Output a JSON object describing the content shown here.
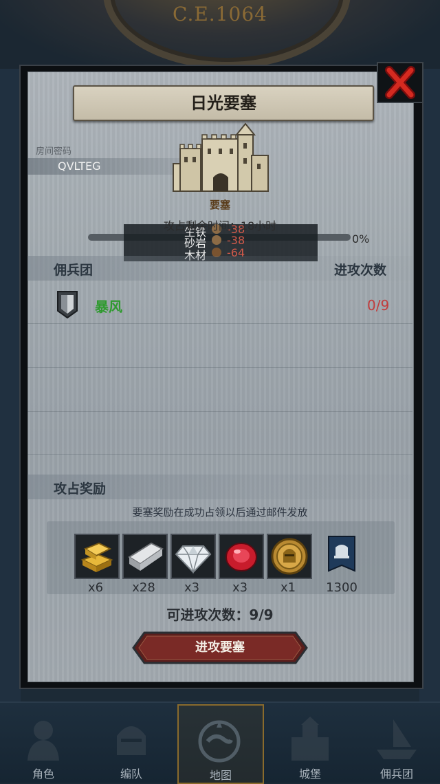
{
  "header": {
    "era": "C.E.1064"
  },
  "dialog": {
    "title": "日光要塞",
    "room_code_label": "房间密码",
    "room_code": "QVLTEG",
    "fortress_type": "要塞",
    "timer_label": "攻占剩余时间：18小时",
    "progress_percent": "0%",
    "resources": [
      {
        "name": "生铁",
        "value": "-38"
      },
      {
        "name": "砂岩",
        "value": "-38"
      },
      {
        "name": "木材",
        "value": "-64"
      }
    ],
    "mercenary_header": "佣兵团",
    "attack_count_header": "进攻次数",
    "mercenaries": [
      {
        "name": "暴风",
        "attacks": "0/9"
      }
    ],
    "reward_header": "攻占奖励",
    "reward_note": "要塞奖励在成功占领以后通过邮件发放",
    "rewards": [
      {
        "icon": "gold-bar-icon",
        "count": "x6"
      },
      {
        "icon": "iron-bar-icon",
        "count": "x28"
      },
      {
        "icon": "diamond-icon",
        "count": "x3"
      },
      {
        "icon": "ruby-icon",
        "count": "x3"
      },
      {
        "icon": "knight-coin-icon",
        "count": "x1"
      },
      {
        "icon": "banner-icon",
        "count": "1300"
      }
    ],
    "attempts_text": "可进攻次数：9/9",
    "attack_button": "进攻要塞"
  },
  "nav": {
    "items": [
      {
        "label": "角色",
        "icon": "knight-icon"
      },
      {
        "label": "编队",
        "icon": "helmet-icon"
      },
      {
        "label": "地图",
        "icon": "map-icon",
        "active": true
      },
      {
        "label": "城堡",
        "icon": "castle-icon"
      },
      {
        "label": "佣兵团",
        "icon": "mercenary-ship-icon"
      }
    ]
  },
  "colors": {
    "accent_red": "#c23c3c",
    "mercenary_green": "#2f9a2f",
    "button_dark_red": "#5a1e1c"
  }
}
